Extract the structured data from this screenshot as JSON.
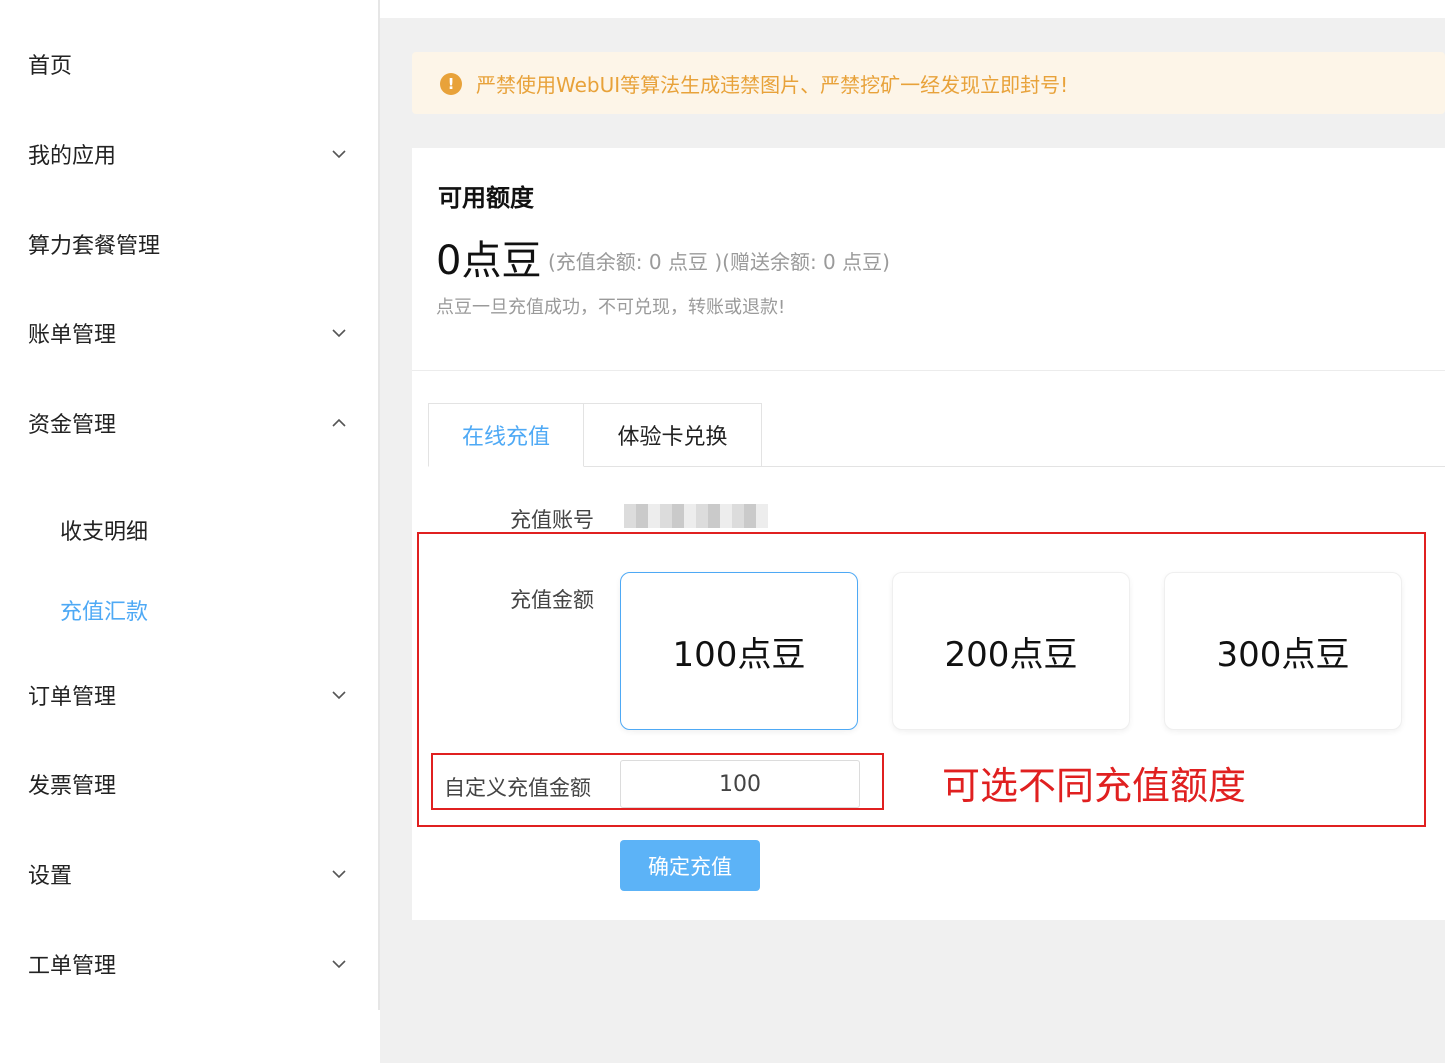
{
  "sidebar": {
    "items": [
      {
        "label": "首页"
      },
      {
        "label": "我的应用"
      },
      {
        "label": "算力套餐管理"
      },
      {
        "label": "账单管理"
      },
      {
        "label": "资金管理"
      },
      {
        "label": "收支明细"
      },
      {
        "label": "充值汇款"
      },
      {
        "label": "订单管理"
      },
      {
        "label": "发票管理"
      },
      {
        "label": "设置"
      },
      {
        "label": "工单管理"
      }
    ]
  },
  "alert": {
    "icon": "exclamation-icon",
    "text": "严禁使用WebUI等算法生成违禁图片、严禁挖矿一经发现立即封号!"
  },
  "quota": {
    "title": "可用额度",
    "amount": "0点豆",
    "detail": "(充值余额: 0 点豆 )(赠送余额: 0 点豆)",
    "note": "点豆一旦充值成功，不可兑现，转账或退款!"
  },
  "tabs": [
    {
      "label": "在线充值"
    },
    {
      "label": "体验卡兑换"
    }
  ],
  "form": {
    "account_label": "充值账号",
    "amount_label": "充值金额",
    "options": [
      "100点豆",
      "200点豆",
      "300点豆"
    ],
    "custom_label": "自定义充值金额",
    "custom_value": "100",
    "submit": "确定充值"
  },
  "annotation": {
    "text": "可选不同充值额度",
    "color": "#e02020"
  },
  "colors": {
    "accent": "#4ea9f5",
    "warning": "#e8a23a",
    "button": "#5cb3f7"
  }
}
